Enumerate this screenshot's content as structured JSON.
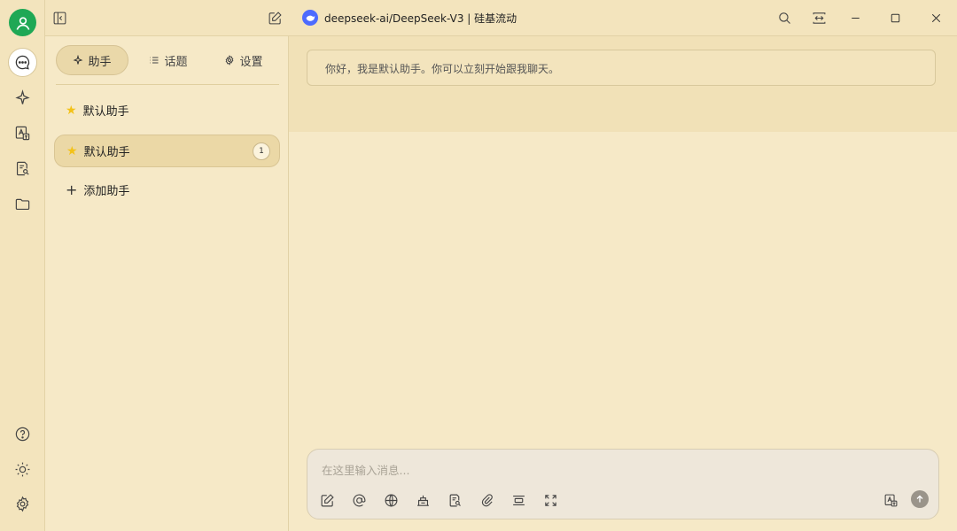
{
  "titlebar": {
    "model_name": "deepseek-ai/DeepSeek-V3 | 硅基流动"
  },
  "rail": {
    "icons": [
      "user-avatar-icon",
      "chat-icon",
      "sparkle-icon",
      "image-translate-icon",
      "doc-search-icon",
      "folder-icon",
      "help-icon",
      "sun-icon",
      "gear-icon"
    ]
  },
  "panel": {
    "tabs": [
      {
        "label": "助手",
        "icon": "sparkle-icon"
      },
      {
        "label": "话题",
        "icon": "list-icon"
      },
      {
        "label": "设置",
        "icon": "gear-icon"
      }
    ],
    "assistants": [
      {
        "name": "默认助手"
      },
      {
        "name": "默认助手",
        "count": "1"
      }
    ],
    "add_label": "添加助手"
  },
  "chat": {
    "greeting": "你好，我是默认助手。你可以立刻开始跟我聊天。",
    "input_placeholder": "在这里输入消息..."
  },
  "colors": {
    "accent_green": "#1fa855",
    "background": "#f6e9c7",
    "star": "#f3c218",
    "deepseek_blue": "#4d6bfe"
  }
}
